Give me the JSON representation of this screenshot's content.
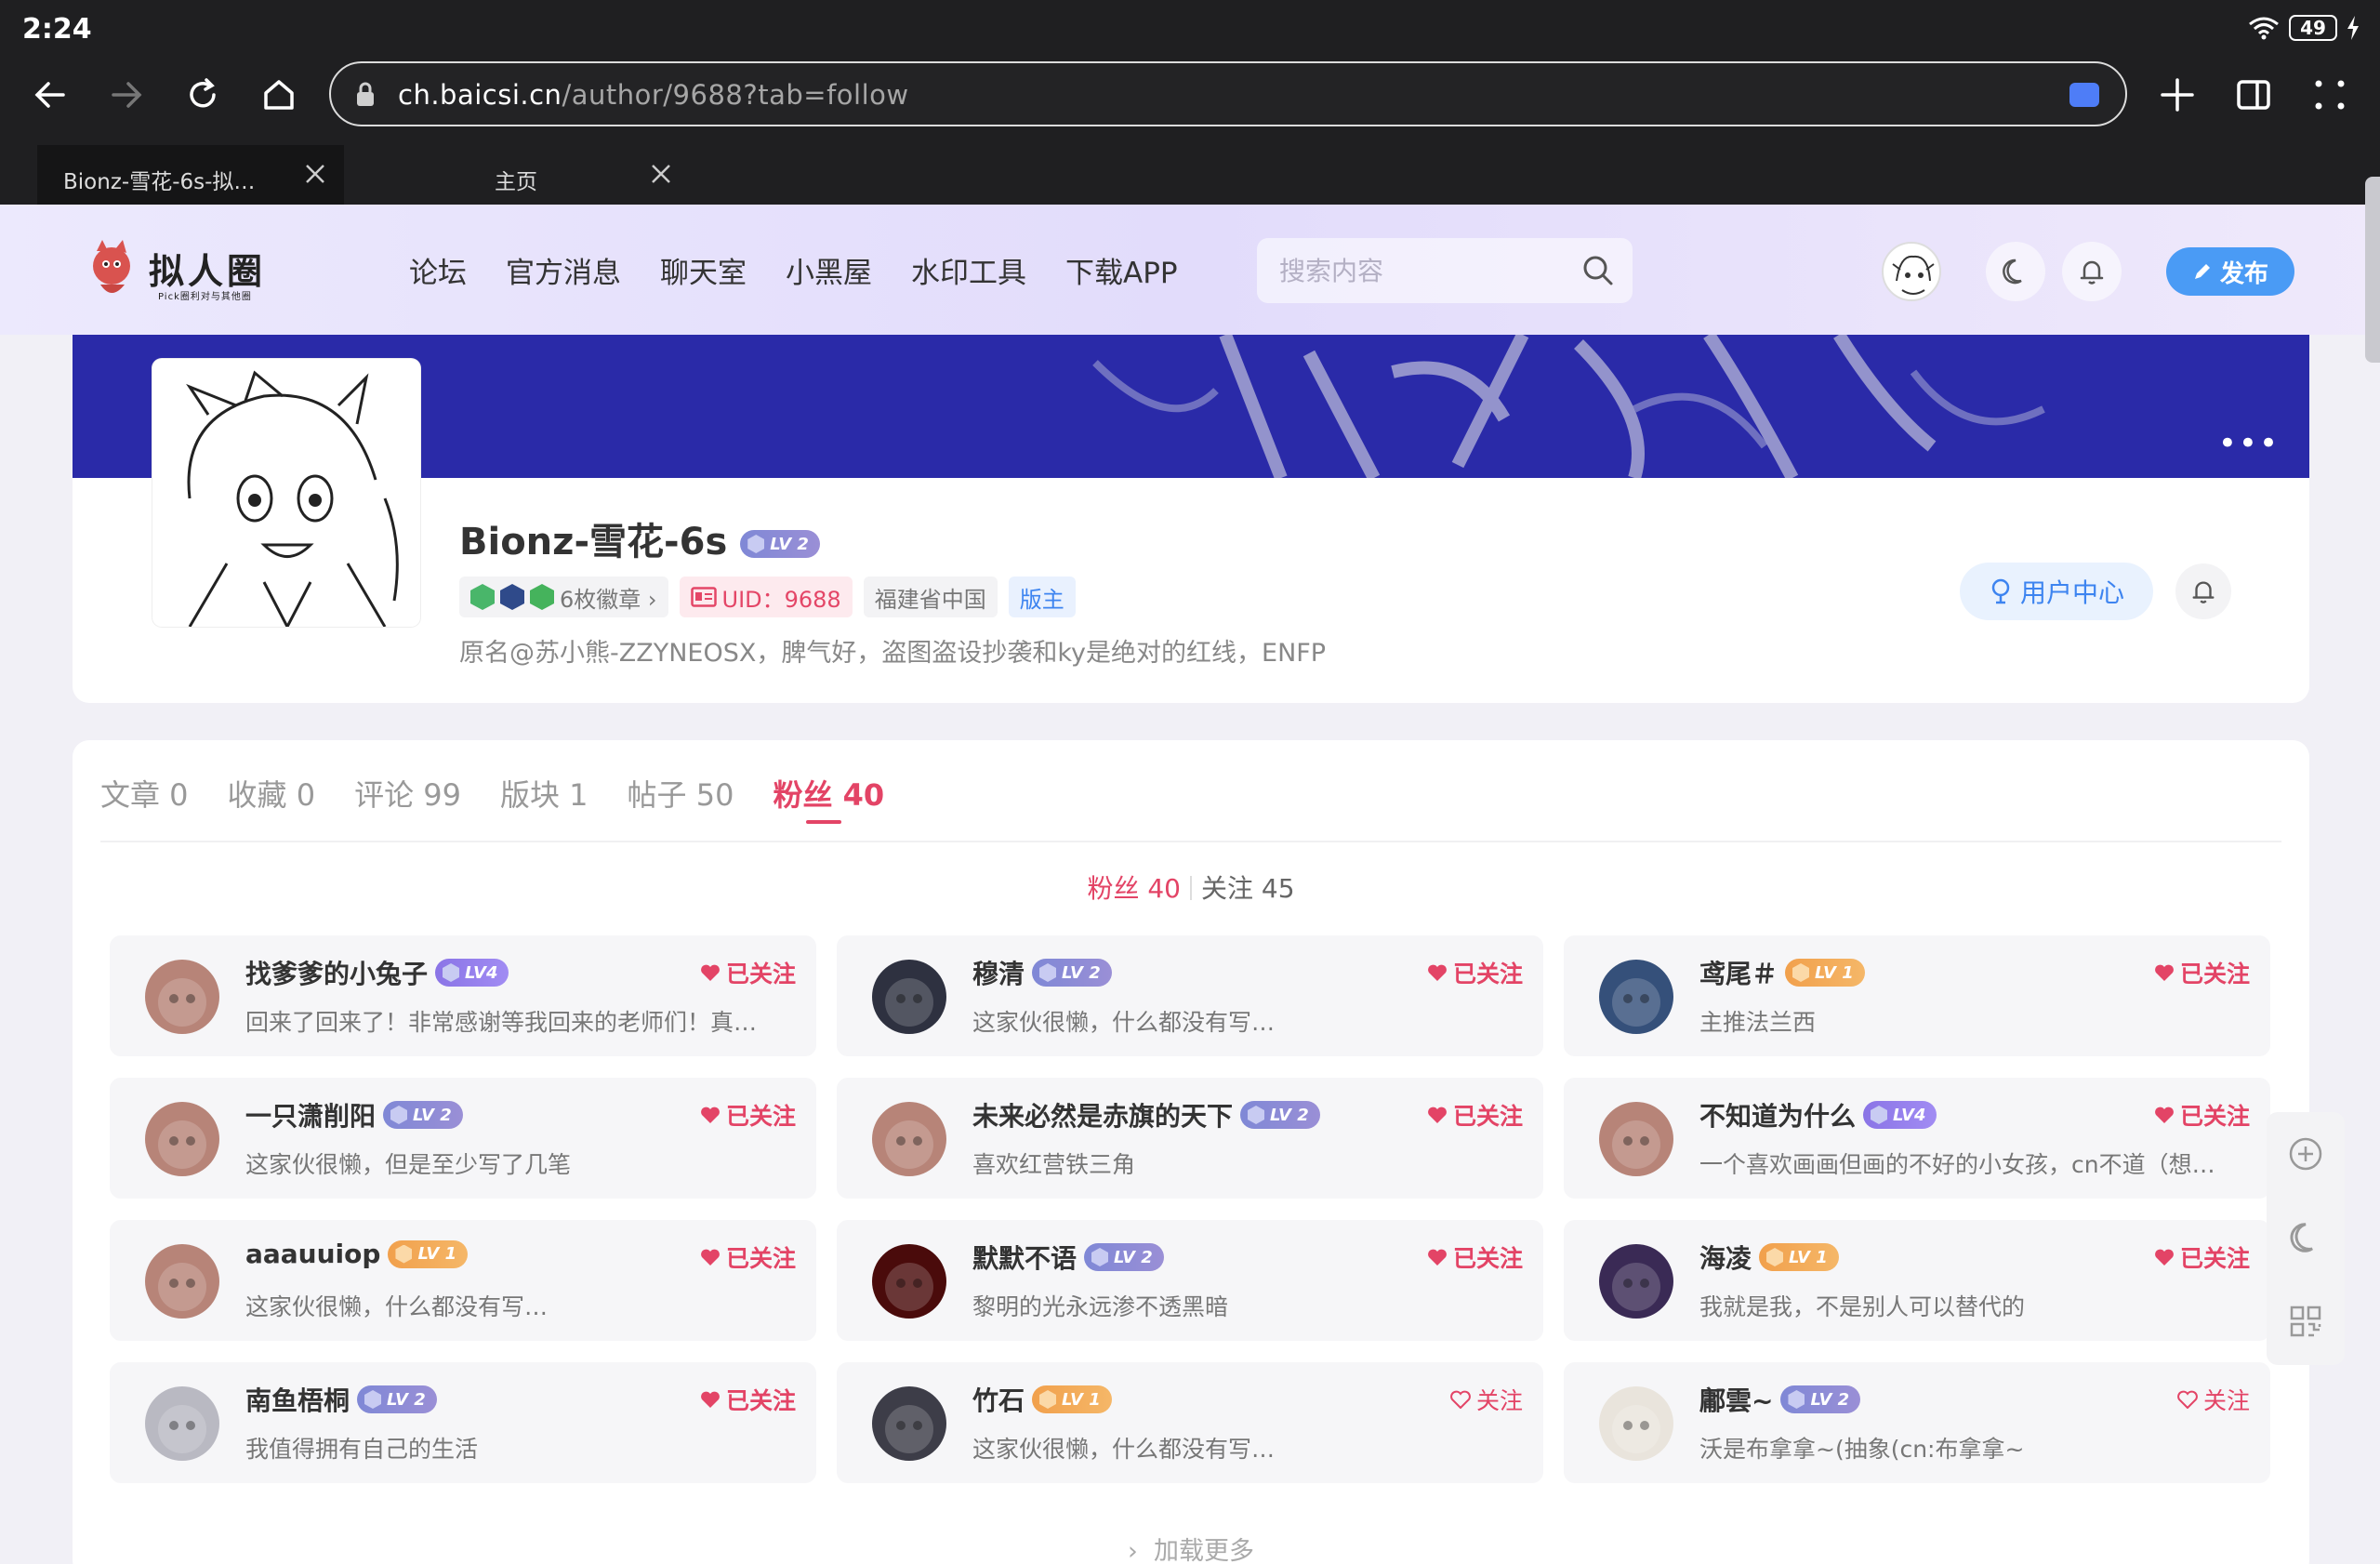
{
  "status": {
    "time": "2:24",
    "battery": "49"
  },
  "browser": {
    "url_host": "ch.baicsi.cn",
    "url_path": "/author/9688?tab=follow",
    "tabs": [
      {
        "title": "Bionz-雪花-6s-拟…"
      },
      {
        "title": "主页"
      }
    ]
  },
  "header": {
    "logo_text": "拟人圈",
    "logo_sub": "Pick圈利对与其他圈",
    "menu": [
      "论坛",
      "官方消息",
      "聊天室",
      "小黑屋",
      "水印工具",
      "下载APP"
    ],
    "search_placeholder": "搜索内容",
    "publish_label": "发布"
  },
  "profile": {
    "name": "Bionz-雪花-6s",
    "level": "LV 2",
    "badges_label": "6枚徽章 ›",
    "uid": "UID：9688",
    "location": "福建省中国",
    "role": "版主",
    "bio": "原名@苏小熊-ZZYNEOSX，脾气好，盗图盗设抄袭和ky是绝对的红线，ENFP",
    "user_center_label": "用户中心"
  },
  "tabs": [
    "文章 0",
    "收藏 0",
    "评论 99",
    "版块 1",
    "帖子 50",
    "粉丝 40"
  ],
  "subtabs": {
    "fans": "粉丝 40",
    "follow": "关注 45"
  },
  "users": [
    {
      "name": "找爹爹的小兔子",
      "level": "LV4",
      "lv_color": "purple",
      "desc": "回来了回来了！非常感谢等我回来的老师们！真…",
      "follow": "已关注",
      "avatar_color": "#b78478"
    },
    {
      "name": "穆清",
      "level": "LV 2",
      "lv_color": "blue",
      "desc": "这家伙很懒，什么都没有写…",
      "follow": "已关注",
      "avatar_color": "#2e3140"
    },
    {
      "name": "鸢尾＃",
      "level": "LV 1",
      "lv_color": "orange",
      "desc": "主推法兰西",
      "follow": "已关注",
      "avatar_color": "#35507a"
    },
    {
      "name": "一只潇削阳",
      "level": "LV 2",
      "lv_color": "blue",
      "desc": "这家伙很懒，但是至少写了几笔",
      "follow": "已关注",
      "avatar_color": "#b78478"
    },
    {
      "name": "未来必然是赤旗的天下",
      "level": "LV 2",
      "lv_color": "blue",
      "desc": "喜欢红营铁三角",
      "follow": "已关注",
      "avatar_color": "#b78478"
    },
    {
      "name": "不知道为什么",
      "level": "LV4",
      "lv_color": "purple",
      "desc": "一个喜欢画画但画的不好的小女孩，cn不道（想…",
      "follow": "已关注",
      "avatar_color": "#b78478"
    },
    {
      "name": "aaauuiop",
      "level": "LV 1",
      "lv_color": "orange",
      "desc": "这家伙很懒，什么都没有写…",
      "follow": "已关注",
      "avatar_color": "#b78478"
    },
    {
      "name": "默默不语",
      "level": "LV 2",
      "lv_color": "blue",
      "desc": "黎明的光永远渗不透黑暗",
      "follow": "已关注",
      "avatar_color": "#4a0b0b"
    },
    {
      "name": "海凌",
      "level": "LV 1",
      "lv_color": "orange",
      "desc": "我就是我，不是别人可以替代的",
      "follow": "已关注",
      "avatar_color": "#3a2a55"
    },
    {
      "name": "南鱼梧桐",
      "level": "LV 2",
      "lv_color": "blue",
      "desc": "我值得拥有自己的生活",
      "follow": "已关注",
      "avatar_color": "#b9b9c2"
    },
    {
      "name": "竹石",
      "level": "LV 1",
      "lv_color": "orange",
      "desc": "这家伙很懒，什么都没有写…",
      "follow": "关注",
      "avatar_color": "#3d3d48"
    },
    {
      "name": "鄘雲~",
      "level": "LV 2",
      "lv_color": "blue",
      "desc": "沃是布拿拿~(抽象(cn:布拿拿~",
      "follow": "关注",
      "avatar_color": "#e9e4dc"
    }
  ],
  "load_more": "加载更多",
  "colors": {
    "accent": "#e34466",
    "primary": "#4a9bf5",
    "banner": "#2a2aa8"
  }
}
